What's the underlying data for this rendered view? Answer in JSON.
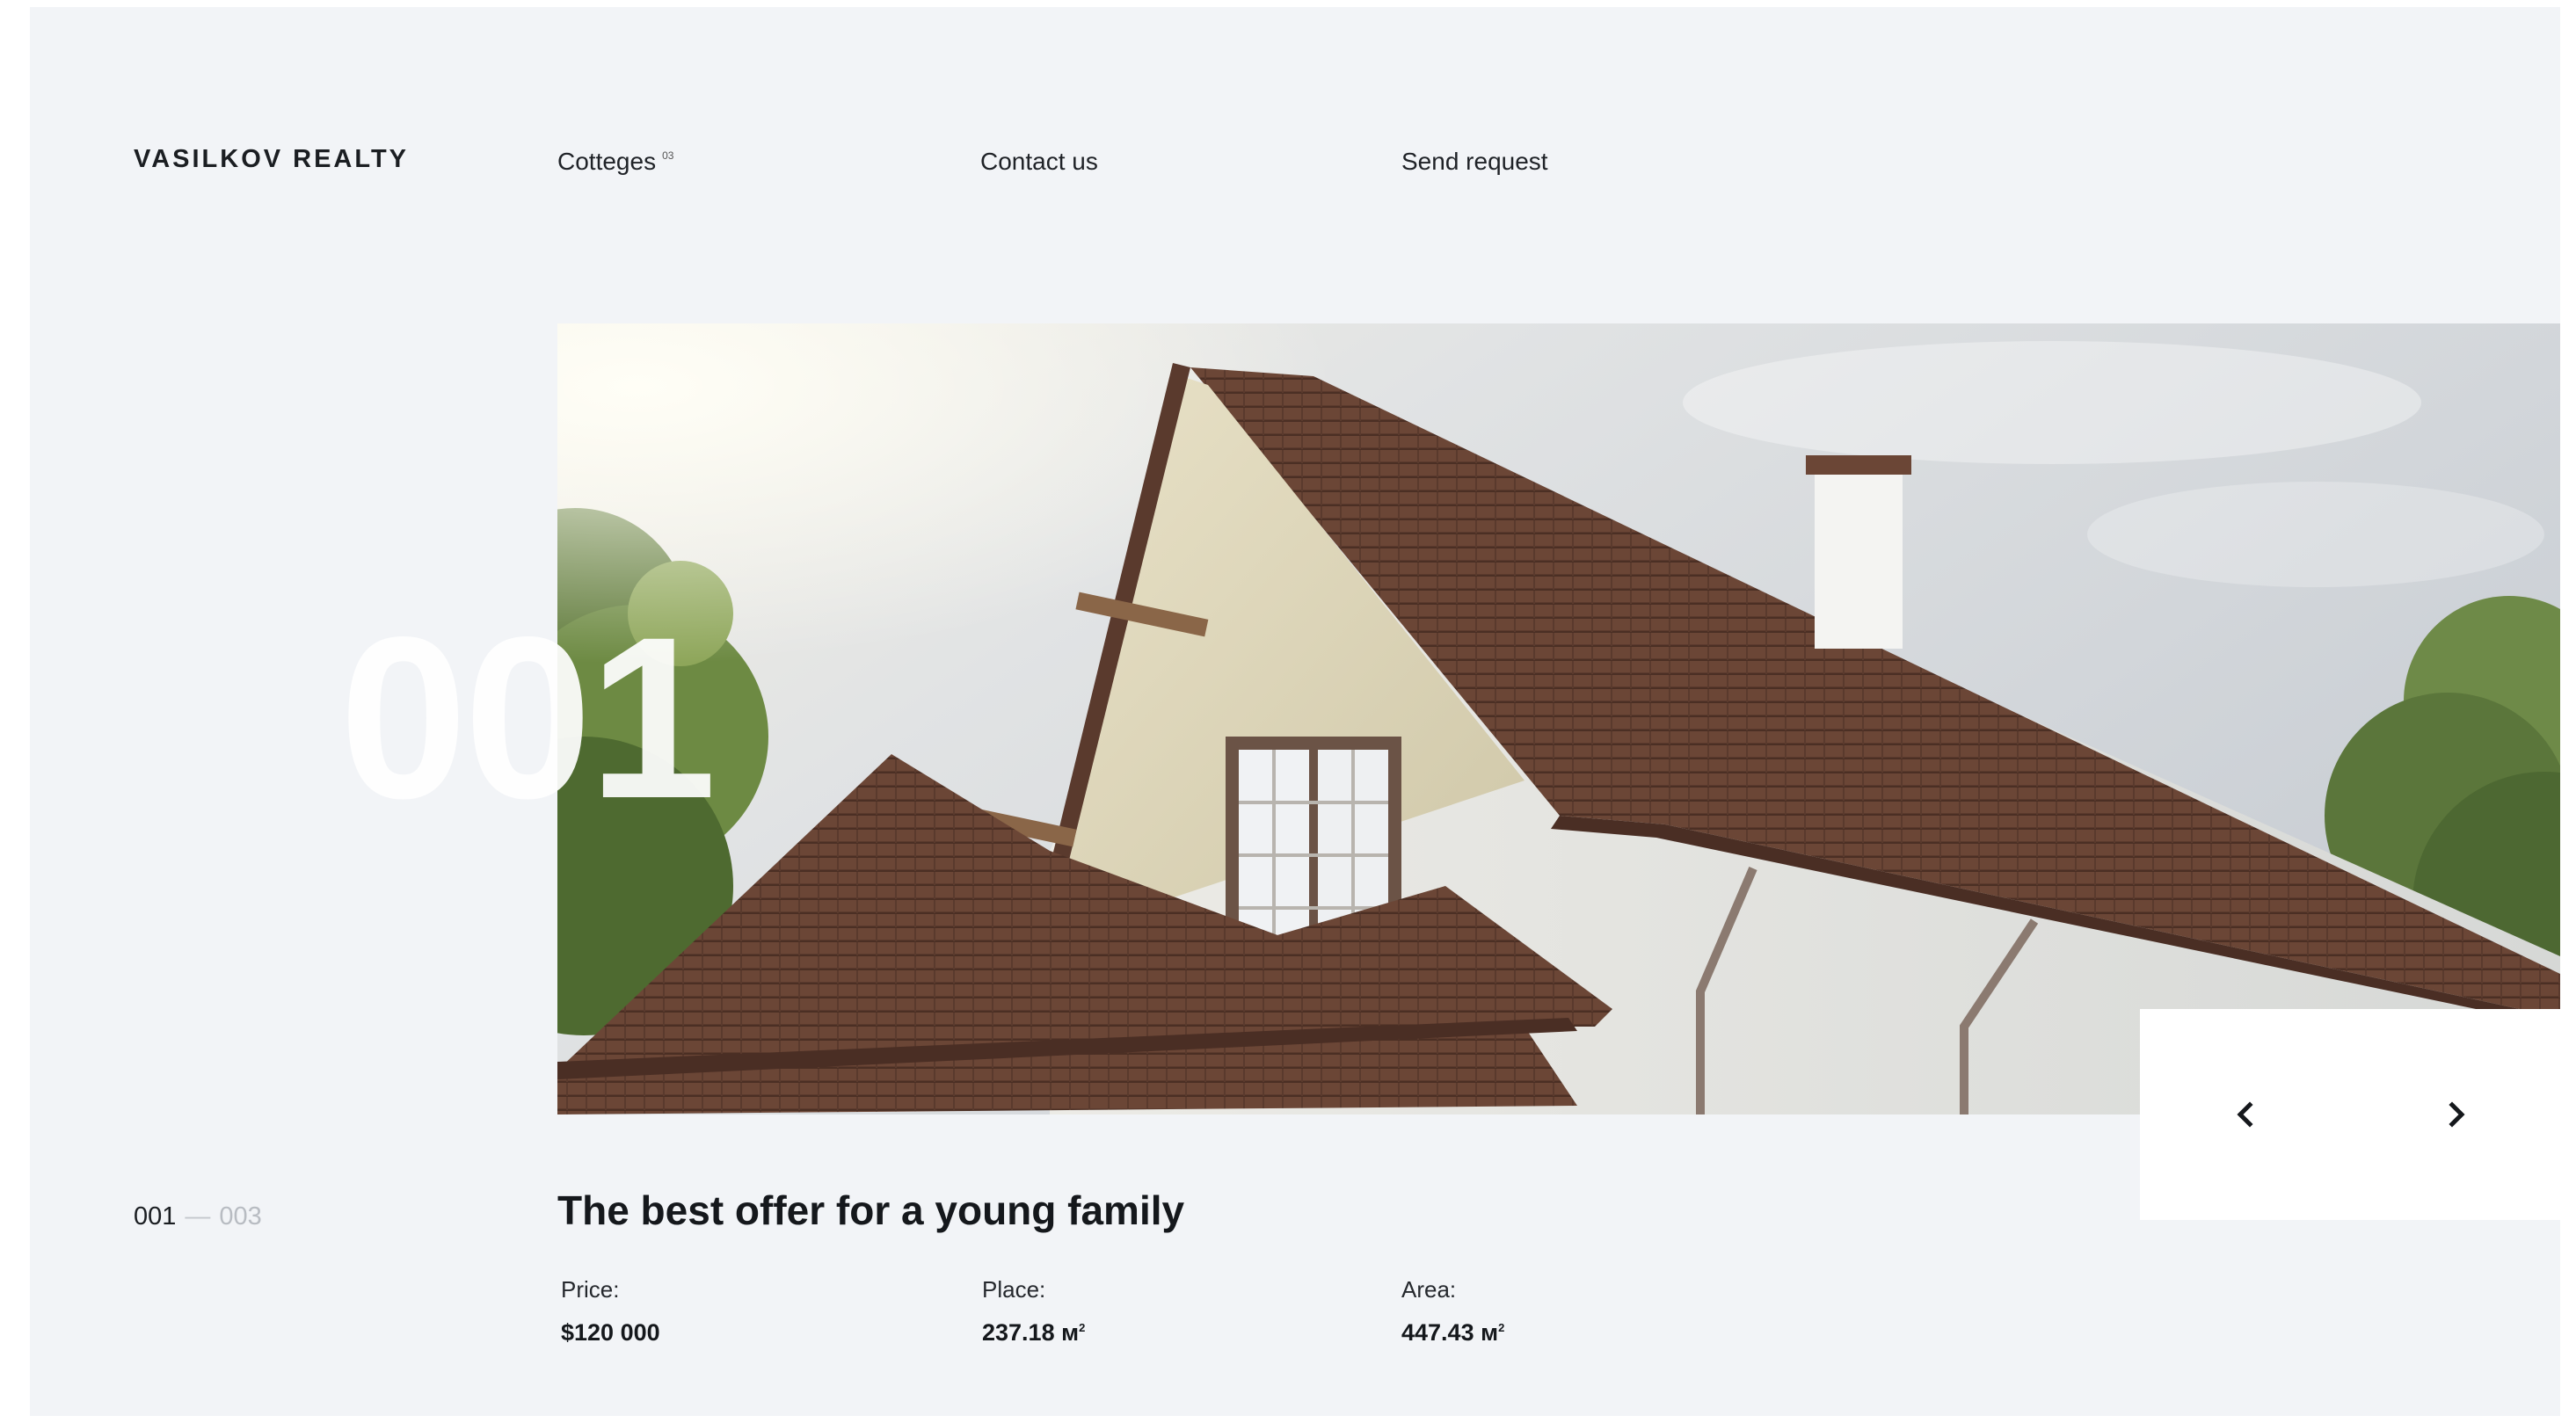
{
  "brand": {
    "logo": "VASILKOV REALTY"
  },
  "nav": {
    "items": [
      {
        "label": "Cotteges",
        "badge": "03"
      },
      {
        "label": "Contact us"
      },
      {
        "label": "Send request"
      }
    ]
  },
  "slide": {
    "big_number": "001",
    "current": "001",
    "separator": "—",
    "total": "003",
    "title": "The best offer for a young family",
    "specs": {
      "price": {
        "label": "Price:",
        "value": "$120 000"
      },
      "place": {
        "label": "Place:",
        "value": "237.18 м",
        "unit_sup": "2"
      },
      "area": {
        "label": "Area:",
        "value": "447.43 м",
        "unit_sup": "2"
      }
    }
  },
  "controls": {
    "prev_icon": "chevron-left-icon",
    "next_icon": "chevron-right-icon"
  },
  "colors": {
    "background": "#f2f4f7",
    "text": "#15181c",
    "muted": "#b8bcc2",
    "roof": "#6e4a3a",
    "wall": "#e6e7e4"
  }
}
